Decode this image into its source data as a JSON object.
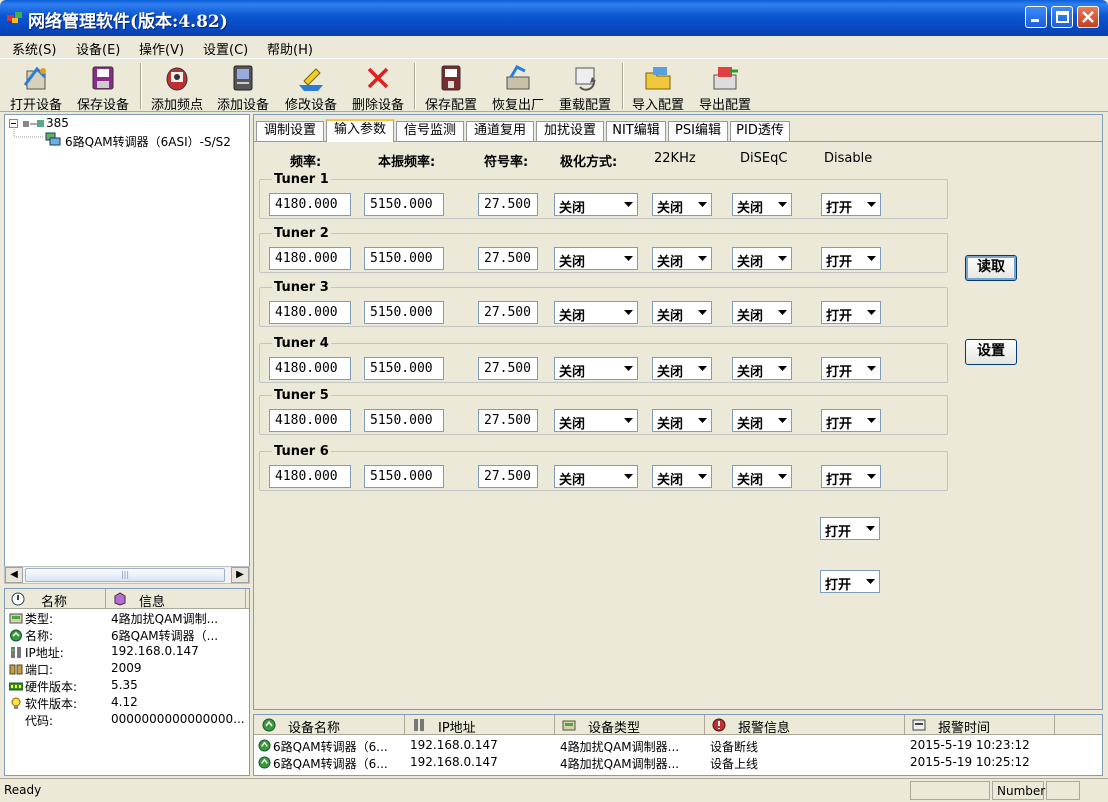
{
  "window": {
    "title": "网络管理软件(版本:4.82)"
  },
  "menu": [
    "系统(S)",
    "设备(E)",
    "操作(V)",
    "设置(C)",
    "帮助(H)"
  ],
  "toolbar": [
    {
      "label": "打开设备",
      "icon": "open-device-icon"
    },
    {
      "label": "保存设备",
      "icon": "save-device-icon"
    },
    {
      "label": "添加频点",
      "icon": "add-frequency-icon"
    },
    {
      "label": "添加设备",
      "icon": "add-device-icon"
    },
    {
      "label": "修改设备",
      "icon": "edit-device-icon"
    },
    {
      "label": "删除设备",
      "icon": "delete-device-icon"
    },
    {
      "label": "保存配置",
      "icon": "save-config-icon"
    },
    {
      "label": "恢复出厂",
      "icon": "factory-reset-icon"
    },
    {
      "label": "重载配置",
      "icon": "reload-config-icon"
    },
    {
      "label": "导入配置",
      "icon": "import-config-icon"
    },
    {
      "label": "导出配置",
      "icon": "export-config-icon"
    }
  ],
  "tree": {
    "root": "385",
    "child": "6路QAM转调器（6ASI）-S/S2"
  },
  "info": {
    "headers": [
      "名称",
      "信息"
    ],
    "rows": [
      {
        "key": "类型:",
        "value": "4路加扰QAM调制...",
        "icon": "type-icon"
      },
      {
        "key": "名称:",
        "value": "6路QAM转调器（...",
        "icon": "name-icon"
      },
      {
        "key": "IP地址:",
        "value": "192.168.0.147",
        "icon": "ip-icon"
      },
      {
        "key": "端口:",
        "value": "2009",
        "icon": "port-icon"
      },
      {
        "key": "硬件版本:",
        "value": "5.35",
        "icon": "hardware-icon"
      },
      {
        "key": "软件版本:",
        "value": "4.12",
        "icon": "software-icon"
      },
      {
        "key": "代码:",
        "value": "0000000000000000...",
        "icon": ""
      }
    ]
  },
  "tabs": [
    "调制设置",
    "输入参数",
    "信号监测",
    "通道复用",
    "加扰设置",
    "NIT编辑",
    "PSI编辑",
    "PID透传"
  ],
  "active_tab": 1,
  "columns": [
    "频率:",
    "本振频率:",
    "符号率:",
    "极化方式:",
    "22KHz",
    "DiSEqC",
    "Disable"
  ],
  "tuners": [
    {
      "name": "Tuner 1",
      "freq": "4180.000",
      "lo": "5150.000",
      "sr": "27.500",
      "pol": "关闭",
      "k22": "关闭",
      "diseqc": "关闭",
      "disable": "打开"
    },
    {
      "name": "Tuner 2",
      "freq": "4180.000",
      "lo": "5150.000",
      "sr": "27.500",
      "pol": "关闭",
      "k22": "关闭",
      "diseqc": "关闭",
      "disable": "打开"
    },
    {
      "name": "Tuner 3",
      "freq": "4180.000",
      "lo": "5150.000",
      "sr": "27.500",
      "pol": "关闭",
      "k22": "关闭",
      "diseqc": "关闭",
      "disable": "打开"
    },
    {
      "name": "Tuner 4",
      "freq": "4180.000",
      "lo": "5150.000",
      "sr": "27.500",
      "pol": "关闭",
      "k22": "关闭",
      "diseqc": "关闭",
      "disable": "打开"
    },
    {
      "name": "Tuner 5",
      "freq": "4180.000",
      "lo": "5150.000",
      "sr": "27.500",
      "pol": "关闭",
      "k22": "关闭",
      "diseqc": "关闭",
      "disable": "打开"
    },
    {
      "name": "Tuner 6",
      "freq": "4180.000",
      "lo": "5150.000",
      "sr": "27.500",
      "pol": "关闭",
      "k22": "关闭",
      "diseqc": "关闭",
      "disable": "打开"
    }
  ],
  "extra_disable": [
    "打开",
    "打开"
  ],
  "buttons": {
    "read": "读取",
    "set": "设置"
  },
  "alarm": {
    "headers": [
      "设备名称",
      "IP地址",
      "设备类型",
      "报警信息",
      "报警时间"
    ],
    "rows": [
      {
        "device": "6路QAM转调器（6...",
        "ip": "192.168.0.147",
        "type": "4路加扰QAM调制器...",
        "msg": "设备断线",
        "time": "2015-5-19 10:23:12"
      },
      {
        "device": "6路QAM转调器（6...",
        "ip": "192.168.0.147",
        "type": "4路加扰QAM调制器...",
        "msg": "设备上线",
        "time": "2015-5-19 10:25:12"
      }
    ]
  },
  "status": {
    "text": "Ready",
    "pane": "Number"
  },
  "colors": {
    "titlebar": "#0b55d0",
    "tab_highlight": "#f5c644",
    "border": "#7f9db9"
  }
}
